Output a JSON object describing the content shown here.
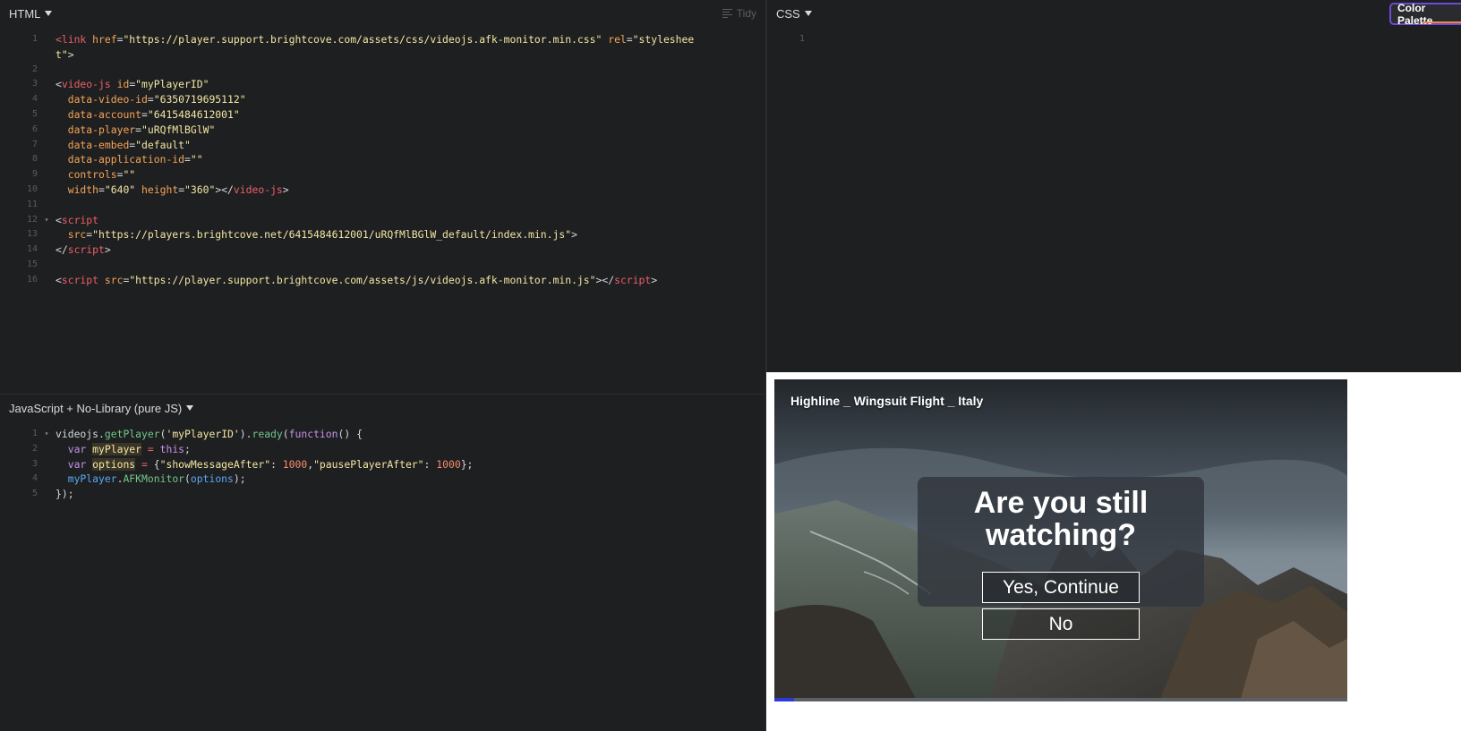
{
  "html_pane": {
    "language": "HTML",
    "tidy_label": "Tidy"
  },
  "css_pane": {
    "language": "CSS",
    "palette_label": "Color Palette",
    "line_number": "1"
  },
  "js_pane": {
    "language": "JavaScript + No-Library (pure JS)"
  },
  "player": {
    "title": "Highline _ Wingsuit Flight _ Italy",
    "question": "Are you still watching?",
    "yes_label": "Yes, Continue",
    "no_label": "No",
    "progress_fraction": 0.035
  },
  "colors": {
    "editor_bg": "#1e1f21",
    "tag": "#ec5f67",
    "attr": "#f5a455",
    "string": "#f4e6a3",
    "function": "#74c68b",
    "keyword": "#c792ea",
    "number": "#f78c6c",
    "palette_border": "#6e48d8",
    "progress": "#2a3bd8"
  },
  "html_code": [
    {
      "n": "1",
      "fold": "",
      "tokens": [
        [
          "tag",
          "<link "
        ],
        [
          "attr",
          "href"
        ],
        [
          "txt",
          "="
        ],
        [
          "str",
          "\"https://player.support.brightcove.com/assets/css/videojs.afk-monitor.min.css\""
        ],
        [
          "txt",
          " "
        ],
        [
          "attr",
          "rel"
        ],
        [
          "txt",
          "="
        ],
        [
          "str",
          "\"styleshee"
        ]
      ]
    },
    {
      "n": "",
      "fold": "",
      "tokens": [
        [
          "str",
          "t\""
        ],
        [
          "txt",
          ">"
        ]
      ]
    },
    {
      "n": "2",
      "fold": "",
      "tokens": []
    },
    {
      "n": "3",
      "fold": "",
      "tokens": [
        [
          "txt",
          "<"
        ],
        [
          "tag",
          "video-js "
        ],
        [
          "attr",
          "id"
        ],
        [
          "txt",
          "="
        ],
        [
          "str",
          "\"myPlayerID\""
        ]
      ]
    },
    {
      "n": "4",
      "fold": "",
      "tokens": [
        [
          "txt",
          "  "
        ],
        [
          "attr",
          "data-video-id"
        ],
        [
          "txt",
          "="
        ],
        [
          "str",
          "\"6350719695112\""
        ]
      ]
    },
    {
      "n": "5",
      "fold": "",
      "tokens": [
        [
          "txt",
          "  "
        ],
        [
          "attr",
          "data-account"
        ],
        [
          "txt",
          "="
        ],
        [
          "str",
          "\"6415484612001\""
        ]
      ]
    },
    {
      "n": "6",
      "fold": "",
      "tokens": [
        [
          "txt",
          "  "
        ],
        [
          "attr",
          "data-player"
        ],
        [
          "txt",
          "="
        ],
        [
          "str",
          "\"uRQfMlBGlW\""
        ]
      ]
    },
    {
      "n": "7",
      "fold": "",
      "tokens": [
        [
          "txt",
          "  "
        ],
        [
          "attr",
          "data-embed"
        ],
        [
          "txt",
          "="
        ],
        [
          "str",
          "\"default\""
        ]
      ]
    },
    {
      "n": "8",
      "fold": "",
      "tokens": [
        [
          "txt",
          "  "
        ],
        [
          "attr",
          "data-application-id"
        ],
        [
          "txt",
          "="
        ],
        [
          "str",
          "\"\""
        ]
      ]
    },
    {
      "n": "9",
      "fold": "",
      "tokens": [
        [
          "txt",
          "  "
        ],
        [
          "attr",
          "controls"
        ],
        [
          "txt",
          "="
        ],
        [
          "str",
          "\"\""
        ]
      ]
    },
    {
      "n": "10",
      "fold": "",
      "tokens": [
        [
          "txt",
          "  "
        ],
        [
          "attr",
          "width"
        ],
        [
          "txt",
          "="
        ],
        [
          "str",
          "\"640\""
        ],
        [
          "txt",
          " "
        ],
        [
          "attr",
          "height"
        ],
        [
          "txt",
          "="
        ],
        [
          "str",
          "\"360\""
        ],
        [
          "txt",
          "></"
        ],
        [
          "tag",
          "video-js"
        ],
        [
          "txt",
          ">"
        ]
      ]
    },
    {
      "n": "11",
      "fold": "",
      "tokens": []
    },
    {
      "n": "12",
      "fold": "▾",
      "tokens": [
        [
          "txt",
          "<"
        ],
        [
          "tag",
          "script"
        ]
      ]
    },
    {
      "n": "13",
      "fold": "",
      "tokens": [
        [
          "txt",
          "  "
        ],
        [
          "attr",
          "src"
        ],
        [
          "txt",
          "="
        ],
        [
          "str",
          "\"https://players.brightcove.net/6415484612001/uRQfMlBGlW_default/index.min.js\""
        ],
        [
          "txt",
          ">"
        ]
      ]
    },
    {
      "n": "14",
      "fold": "",
      "tokens": [
        [
          "txt",
          "</"
        ],
        [
          "tag",
          "script"
        ],
        [
          "txt",
          ">"
        ]
      ]
    },
    {
      "n": "15",
      "fold": "",
      "tokens": []
    },
    {
      "n": "16",
      "fold": "",
      "tokens": [
        [
          "txt",
          "<"
        ],
        [
          "tag",
          "script "
        ],
        [
          "attr",
          "src"
        ],
        [
          "txt",
          "="
        ],
        [
          "str",
          "\"https://player.support.brightcove.com/assets/js/videojs.afk-monitor.min.js\""
        ],
        [
          "txt",
          "></"
        ],
        [
          "tag",
          "script"
        ],
        [
          "txt",
          ">"
        ]
      ]
    }
  ],
  "js_code": [
    {
      "n": "1",
      "fold": "▾",
      "tokens": [
        [
          "txt",
          "videojs."
        ],
        [
          "fn",
          "getPlayer"
        ],
        [
          "txt",
          "("
        ],
        [
          "str",
          "'myPlayerID'"
        ],
        [
          "txt",
          ")."
        ],
        [
          "fn",
          "ready"
        ],
        [
          "txt",
          "("
        ],
        [
          "kw",
          "function"
        ],
        [
          "txt",
          "() {"
        ]
      ]
    },
    {
      "n": "2",
      "fold": "",
      "tokens": [
        [
          "txt",
          "  "
        ],
        [
          "kw",
          "var"
        ],
        [
          "txt",
          " "
        ],
        [
          "var",
          "myPlayer"
        ],
        [
          "txt",
          " "
        ],
        [
          "op",
          "="
        ],
        [
          "txt",
          " "
        ],
        [
          "kw",
          "this"
        ],
        [
          "txt",
          ";"
        ]
      ]
    },
    {
      "n": "3",
      "fold": "",
      "tokens": [
        [
          "txt",
          "  "
        ],
        [
          "kw",
          "var"
        ],
        [
          "txt",
          " "
        ],
        [
          "var",
          "options"
        ],
        [
          "txt",
          " "
        ],
        [
          "op",
          "="
        ],
        [
          "txt",
          " {"
        ],
        [
          "str",
          "\"showMessageAfter\""
        ],
        [
          "txt",
          ": "
        ],
        [
          "num",
          "1000"
        ],
        [
          "txt",
          ","
        ],
        [
          "str",
          "\"pausePlayerAfter\""
        ],
        [
          "txt",
          ": "
        ],
        [
          "num",
          "1000"
        ],
        [
          "txt",
          "};"
        ]
      ]
    },
    {
      "n": "4",
      "fold": "",
      "tokens": [
        [
          "txt",
          "  "
        ],
        [
          "prop",
          "myPlayer"
        ],
        [
          "txt",
          "."
        ],
        [
          "fn",
          "AFKMonitor"
        ],
        [
          "txt",
          "("
        ],
        [
          "prop",
          "options"
        ],
        [
          "txt",
          ");"
        ]
      ]
    },
    {
      "n": "5",
      "fold": "",
      "tokens": [
        [
          "txt",
          "});"
        ]
      ]
    }
  ]
}
